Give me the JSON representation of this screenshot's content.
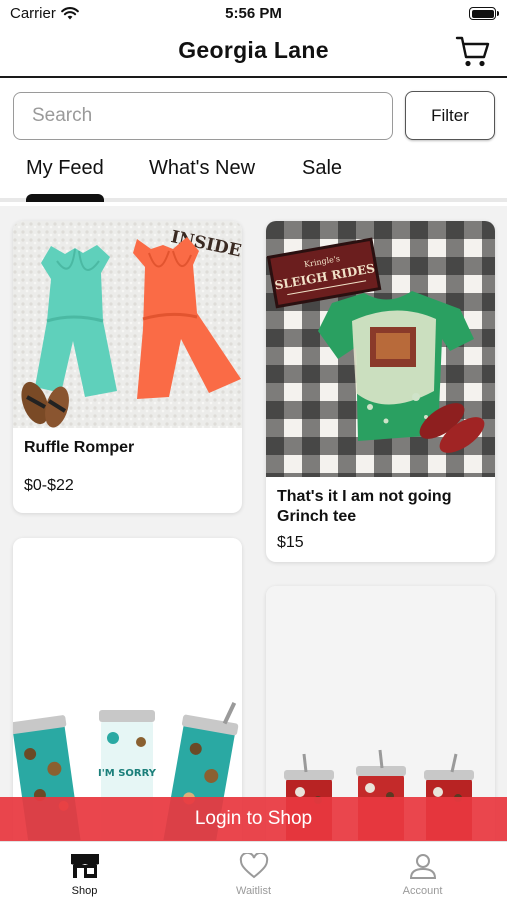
{
  "status_bar": {
    "carrier": "Carrier",
    "time": "5:56 PM"
  },
  "header": {
    "title": "Georgia Lane",
    "cart_icon": "cart-icon"
  },
  "search": {
    "placeholder": "Search",
    "filter_label": "Filter"
  },
  "tabs": [
    {
      "label": "My Feed",
      "active": true
    },
    {
      "label": "What's New",
      "active": false
    },
    {
      "label": "Sale",
      "active": false
    }
  ],
  "products": [
    {
      "title": "Ruffle Romper",
      "price": "$0-$22"
    },
    {
      "title": "That's it I am not going Grinch tee",
      "price": "$15"
    },
    {
      "title": "",
      "price": ""
    },
    {
      "title": "",
      "price": ""
    }
  ],
  "image_text": {
    "sleigh_sign_top": "Kringle's",
    "sleigh_sign": "SLEIGH RIDES",
    "inside_sign": "INSIDE",
    "tumbler_text": "I'M SORRY"
  },
  "login_banner": "Login to Shop",
  "bottom_nav": [
    {
      "label": "Shop",
      "icon": "storefront-icon",
      "active": true
    },
    {
      "label": "Waitlist",
      "icon": "heart-icon",
      "active": false
    },
    {
      "label": "Account",
      "icon": "person-icon",
      "active": false
    }
  ],
  "colors": {
    "accent": "#E83840",
    "text": "#111111",
    "muted": "#9A9A9A"
  }
}
